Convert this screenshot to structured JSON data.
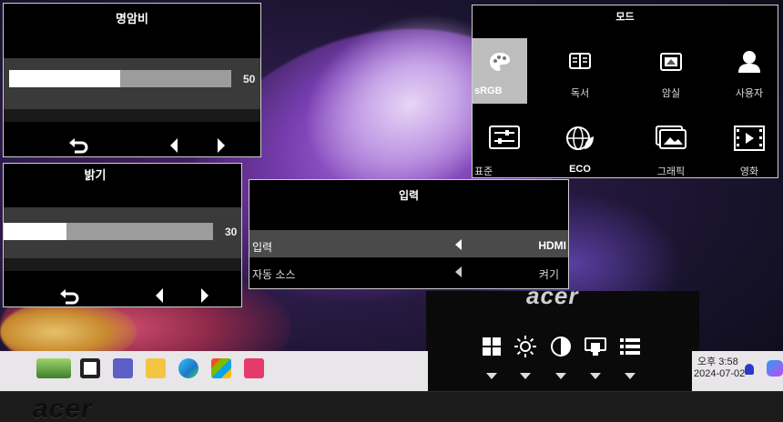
{
  "brightness_contrast_panel": {
    "title": "명암비",
    "value": "50",
    "level": 50
  },
  "brightness_panel": {
    "title": "밝기",
    "value": "30",
    "level": 30
  },
  "mode_panel": {
    "title": "모드",
    "modes": [
      {
        "label": "sRGB",
        "icon": "palette-icon",
        "selected": true
      },
      {
        "label": "독서",
        "icon": "book-icon",
        "selected": false
      },
      {
        "label": "암실",
        "icon": "dark-room-icon",
        "selected": false
      },
      {
        "label": "사용자",
        "icon": "user-icon",
        "selected": false
      },
      {
        "label": "표준",
        "icon": "sliders-icon",
        "selected": false
      },
      {
        "label": "ECO",
        "icon": "eco-globe-icon",
        "selected": false
      },
      {
        "label": "그래픽",
        "icon": "graphics-icon",
        "selected": false
      },
      {
        "label": "영화",
        "icon": "movie-icon",
        "selected": false
      }
    ]
  },
  "input_panel": {
    "title": "입력",
    "rows": [
      {
        "label": "입력",
        "value": "HDMI"
      },
      {
        "label": "자동 소스",
        "value": "켜기"
      }
    ]
  },
  "monitor": {
    "logo": "acer",
    "bezel_logo": "acer",
    "hotkeys": [
      "grid-icon",
      "brightness-icon",
      "contrast-icon",
      "input-icon",
      "menu-list-icon"
    ]
  },
  "taskbar": {
    "time": "오후 3:58",
    "date": "2024-07-02"
  }
}
